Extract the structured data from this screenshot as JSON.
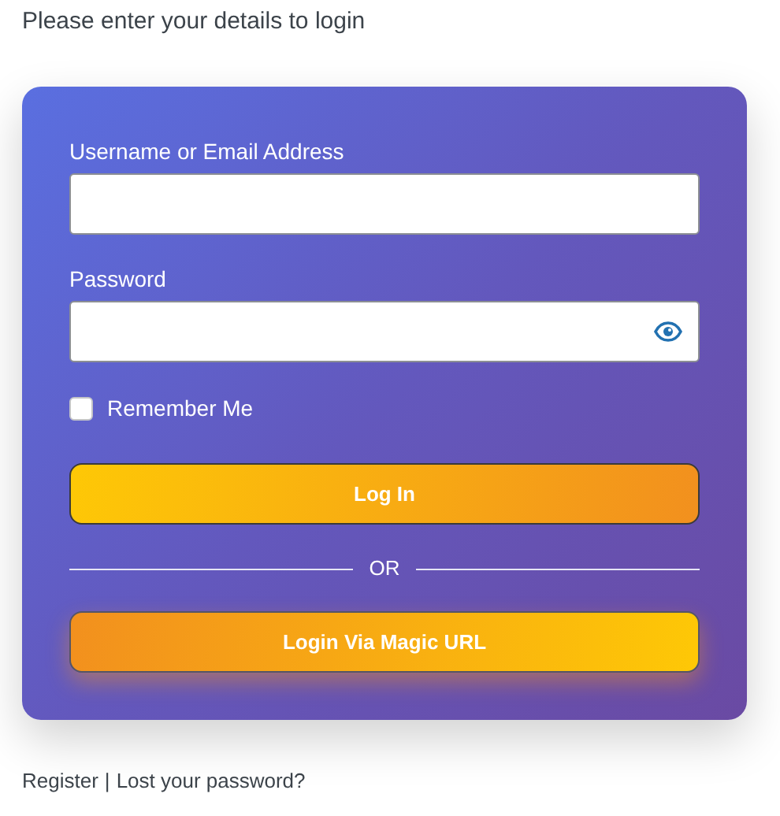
{
  "heading": "Please enter your details to login",
  "fields": [
    {
      "label": "Username or Email Address",
      "kind": "text"
    },
    {
      "label": "Password",
      "kind": "password"
    }
  ],
  "remember": {
    "label": "Remember Me",
    "checked": false
  },
  "login_button": "Log In",
  "divider": "OR",
  "magic_button": "Login Via Magic URL",
  "footer": {
    "links": [
      "Register",
      "Lost your password?"
    ],
    "separator": "|"
  }
}
